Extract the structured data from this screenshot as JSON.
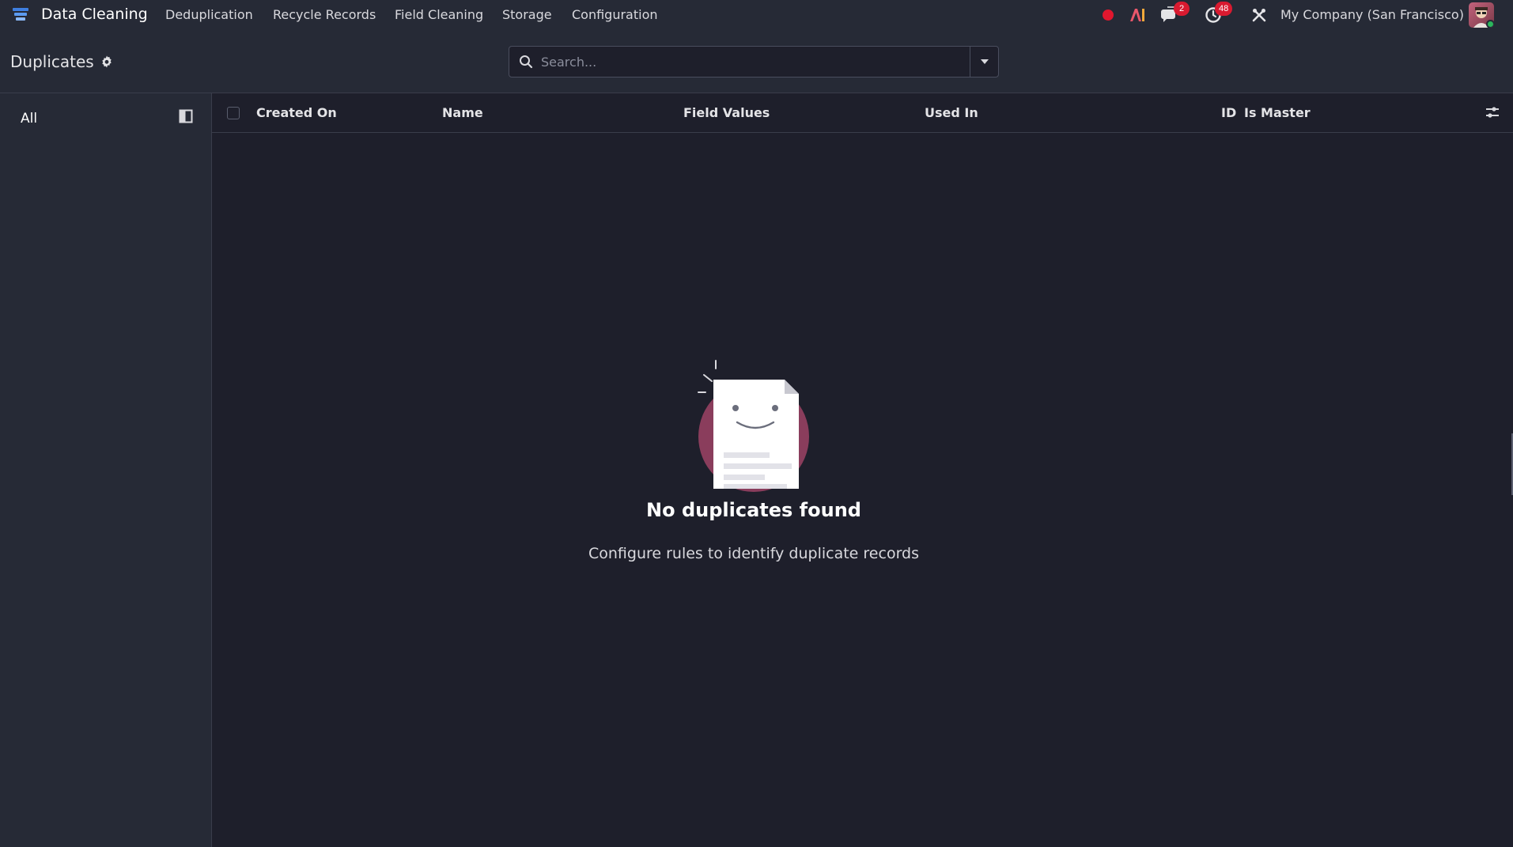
{
  "app": {
    "name": "Data Cleaning",
    "menu": [
      "Deduplication",
      "Recycle Records",
      "Field Cleaning",
      "Storage",
      "Configuration"
    ],
    "icons": [
      "record-icon",
      "ai-icon",
      "chat-icon",
      "clock-icon",
      "tools-icon"
    ],
    "messages_count": "2",
    "activities_count": "48",
    "company": "My Company (San Francisco)",
    "accent_color": "#d91a30"
  },
  "control": {
    "breadcrumb": "Duplicates",
    "search_placeholder": "Search..."
  },
  "sidebar": {
    "items": [
      {
        "label": "All"
      }
    ]
  },
  "list": {
    "columns": [
      "Created On",
      "Name",
      "Field Values",
      "Used In",
      "ID",
      "Is Master"
    ]
  },
  "empty_state": {
    "title": "No duplicates found",
    "subtitle": "Configure rules to identify duplicate records"
  }
}
